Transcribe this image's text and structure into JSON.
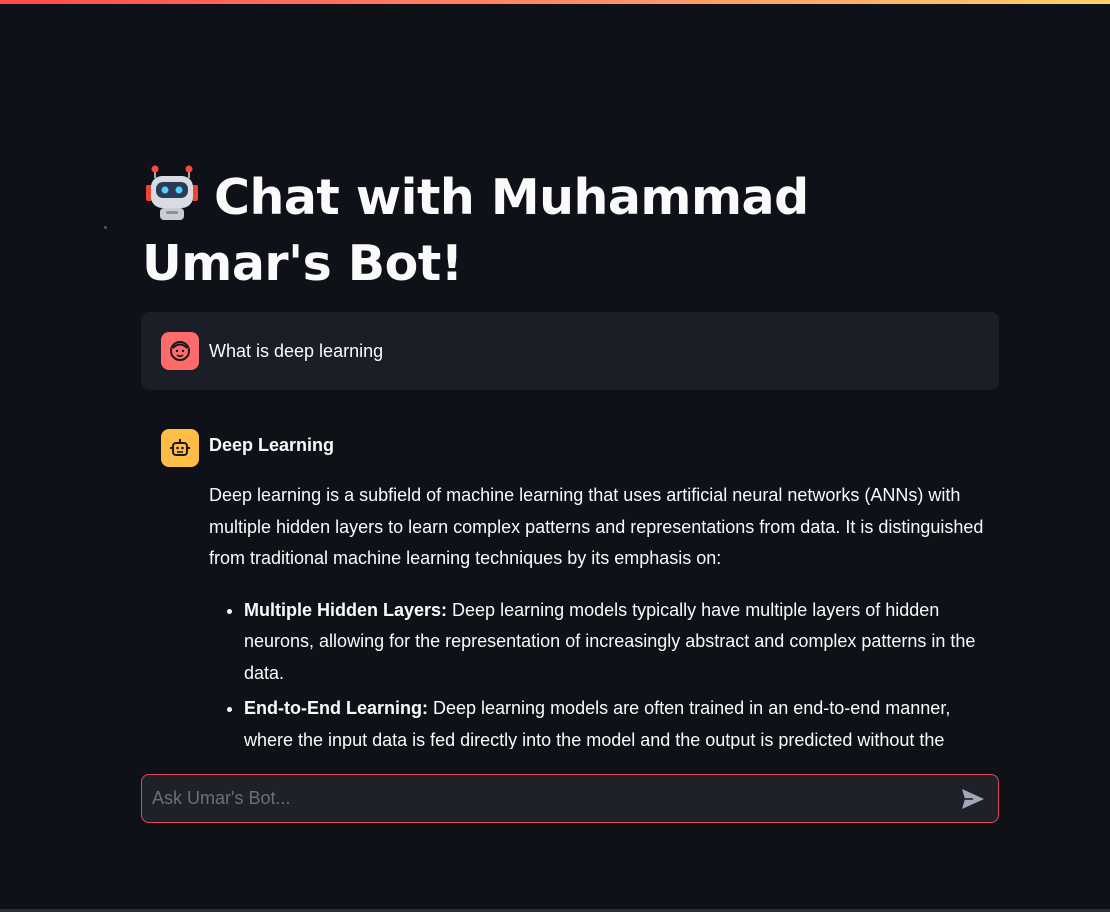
{
  "title": "Chat with Muhammad Umar's Bot!",
  "title_icon": "robot-emoji-icon",
  "messages": {
    "user": {
      "avatar_icon": "user-face-icon",
      "avatar_color": "#ff6b6b",
      "text": "What is deep learning"
    },
    "bot": {
      "avatar_icon": "bot-face-icon",
      "avatar_color": "#ffbd45",
      "heading": "Deep Learning",
      "paragraph": "Deep learning is a subfield of machine learning that uses artificial neural networks (ANNs) with multiple hidden layers to learn complex patterns and representations from data. It is distinguished from traditional machine learning techniques by its emphasis on:",
      "bullets": [
        {
          "title": "Multiple Hidden Layers:",
          "text": " Deep learning models typically have multiple layers of hidden neurons, allowing for the representation of increasingly abstract and complex patterns in the data."
        },
        {
          "title": "End-to-End Learning:",
          "text": " Deep learning models are often trained in an end-to-end manner, where the input data is fed directly into the model and the output is predicted without the"
        }
      ]
    }
  },
  "chat_input": {
    "placeholder": "Ask Umar's Bot...",
    "value": "",
    "border_color": "#e14b53",
    "send_icon": "send-arrow-icon"
  },
  "colors": {
    "background": "#0e1117",
    "user_bubble": "#1b1e26",
    "text": "#fafafa"
  }
}
